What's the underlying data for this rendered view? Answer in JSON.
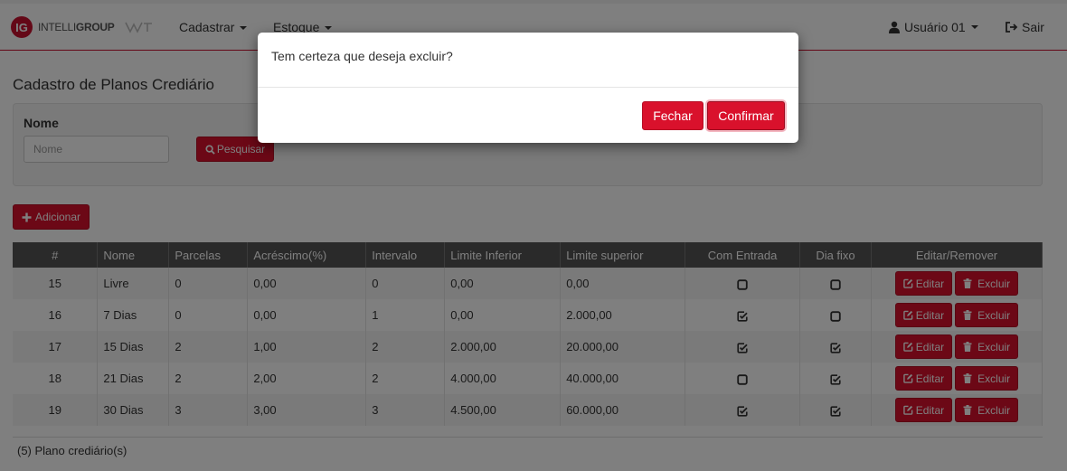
{
  "navbar": {
    "brand_mark": "IG",
    "brand_light": "INTELLI",
    "brand_bold": "GROUP",
    "menu": [
      "Cadastrar",
      "Estoque"
    ],
    "user_label": "Usuário 01",
    "logout_label": "Sair"
  },
  "page": {
    "title": "Cadastro de Planos Crediário",
    "search_label": "Nome",
    "search_placeholder": "Nome",
    "search_button": "Pesquisar",
    "add_button": "Adicionar"
  },
  "table": {
    "headers": [
      "#",
      "Nome",
      "Parcelas",
      "Acréscimo(%)",
      "Intervalo",
      "Limite Inferior",
      "Limite superior",
      "Com Entrada",
      "Dia fixo",
      "Editar/Remover"
    ],
    "edit_label": "Editar",
    "delete_label": "Excluir",
    "rows": [
      {
        "id": "15",
        "nome": "Livre",
        "parcelas": "0",
        "acrescimo": "0,00",
        "intervalo": "0",
        "limite_inferior": "0,00",
        "limite_superior": "0,00",
        "com_entrada": false,
        "dia_fixo": false
      },
      {
        "id": "16",
        "nome": "7 Dias",
        "parcelas": "0",
        "acrescimo": "0,00",
        "intervalo": "1",
        "limite_inferior": "0,00",
        "limite_superior": "2.000,00",
        "com_entrada": true,
        "dia_fixo": false
      },
      {
        "id": "17",
        "nome": "15 Dias",
        "parcelas": "2",
        "acrescimo": "1,00",
        "intervalo": "2",
        "limite_inferior": "2.000,00",
        "limite_superior": "20.000,00",
        "com_entrada": true,
        "dia_fixo": true
      },
      {
        "id": "18",
        "nome": "21 Dias",
        "parcelas": "2",
        "acrescimo": "2,00",
        "intervalo": "2",
        "limite_inferior": "4.000,00",
        "limite_superior": "40.000,00",
        "com_entrada": false,
        "dia_fixo": true
      },
      {
        "id": "19",
        "nome": "30 Dias",
        "parcelas": "3",
        "acrescimo": "3,00",
        "intervalo": "3",
        "limite_inferior": "4.500,00",
        "limite_superior": "60.000,00",
        "com_entrada": true,
        "dia_fixo": true
      }
    ],
    "footer": "(5) Plano crediário(s)"
  },
  "modal": {
    "message": "Tem certeza que deseja excluir?",
    "close_button": "Fechar",
    "confirm_button": "Confirmar"
  },
  "icons": {
    "user": "user-icon",
    "logout": "sign-out-icon",
    "search": "search-icon",
    "add": "plus-icon",
    "edit": "edit-icon",
    "delete": "trash-icon",
    "checked": "checked-square-icon",
    "unchecked": "empty-square-icon"
  },
  "colors": {
    "accent": "#d9112c",
    "header_bg": "#555555"
  }
}
